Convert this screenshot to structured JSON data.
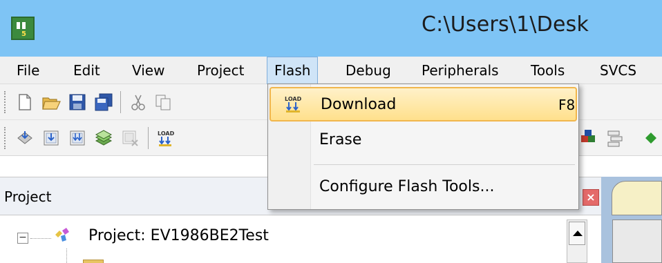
{
  "window": {
    "title": "C:\\Users\\1\\Desk",
    "icon": "uvision-icon"
  },
  "menu": {
    "items": [
      "File",
      "Edit",
      "View",
      "Project",
      "Flash",
      "Debug",
      "Peripherals",
      "Tools",
      "SVCS"
    ],
    "active": "Flash"
  },
  "flash_menu": {
    "items": [
      {
        "label": "Download",
        "shortcut": "F8",
        "icon": "load-icon",
        "highlighted": true
      },
      {
        "label": "Erase",
        "shortcut": "",
        "icon": "",
        "highlighted": false
      },
      {
        "label": "Configure Flash Tools...",
        "shortcut": "",
        "icon": "",
        "highlighted": false
      }
    ]
  },
  "toolbar1": {
    "icons": [
      "new-file-icon",
      "open-folder-icon",
      "save-icon",
      "save-all-icon",
      "cut-icon",
      "copy-icon"
    ]
  },
  "toolbar2": {
    "icons": [
      "translate-icon",
      "build-icon",
      "rebuild-icon",
      "batch-build-icon",
      "stop-build-icon",
      "load-icon"
    ]
  },
  "project_panel": {
    "title": "Project",
    "root_label": "Project: EV1986BE2Test"
  },
  "colors": {
    "titlebar": "#7ec4f5",
    "menu_highlight": "#cfe4f7",
    "dropdown_highlight": "#ffe08c"
  }
}
